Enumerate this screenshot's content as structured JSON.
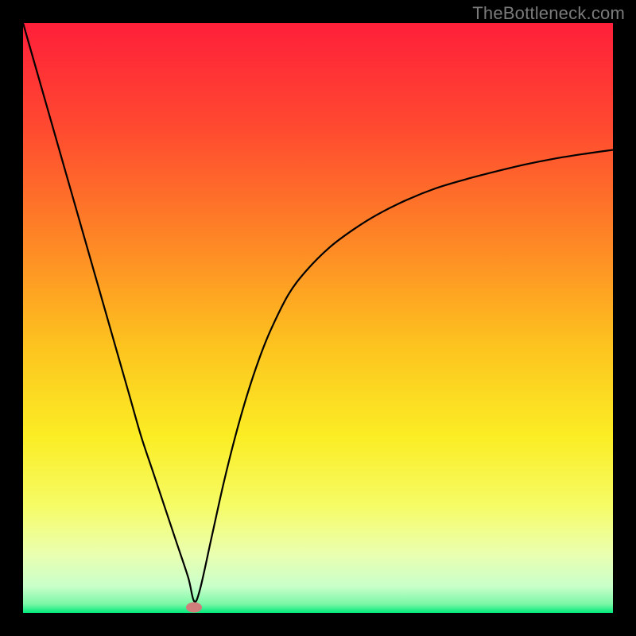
{
  "attribution": "TheBottleneck.com",
  "chart_data": {
    "type": "line",
    "title": "",
    "xlabel": "",
    "ylabel": "",
    "xlim": [
      0,
      100
    ],
    "ylim": [
      0,
      100
    ],
    "background_gradient": {
      "stops": [
        {
          "offset": 0,
          "color": "#ff1f3a"
        },
        {
          "offset": 0.18,
          "color": "#ff4a30"
        },
        {
          "offset": 0.38,
          "color": "#fe8a25"
        },
        {
          "offset": 0.55,
          "color": "#fdc41f"
        },
        {
          "offset": 0.7,
          "color": "#fbed24"
        },
        {
          "offset": 0.82,
          "color": "#f6fc67"
        },
        {
          "offset": 0.9,
          "color": "#eaffb0"
        },
        {
          "offset": 0.955,
          "color": "#c9ffca"
        },
        {
          "offset": 0.985,
          "color": "#7af7a6"
        },
        {
          "offset": 1.0,
          "color": "#00e97b"
        }
      ]
    },
    "series": [
      {
        "name": "bottleneck-curve",
        "color": "#000000",
        "x": [
          0,
          2,
          4,
          6,
          8,
          10,
          12,
          14,
          16,
          18,
          20,
          22,
          24,
          26,
          28,
          29,
          30,
          32,
          34,
          36,
          38,
          40,
          42,
          45,
          48,
          52,
          56,
          60,
          65,
          70,
          75,
          80,
          85,
          90,
          95,
          100
        ],
        "y": [
          100,
          93,
          86,
          79,
          72,
          65,
          58,
          51,
          44,
          37,
          30,
          24,
          18,
          12,
          6,
          2,
          4,
          13,
          22,
          30,
          37,
          43,
          48,
          54,
          58,
          62,
          65,
          67.5,
          70,
          72,
          73.5,
          74.8,
          76,
          77,
          77.8,
          78.5
        ]
      }
    ],
    "markers": [
      {
        "name": "valley-marker",
        "x": 29,
        "y": 1,
        "color": "#cf7e7c"
      }
    ]
  }
}
